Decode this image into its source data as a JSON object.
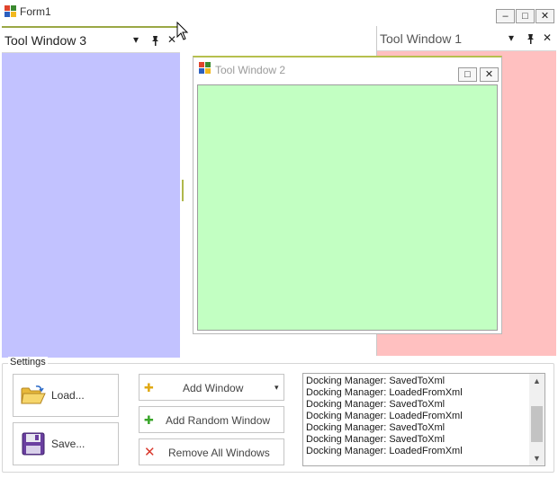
{
  "window": {
    "title": "Form1",
    "minimize_glyph": "–",
    "maximize_glyph": "□",
    "close_glyph": "✕"
  },
  "tool_window_3": {
    "title": "Tool Window 3",
    "color": "#c2c2ff"
  },
  "tool_window_1": {
    "title": "Tool Window 1",
    "color": "#ffc0c0"
  },
  "tool_window_2": {
    "title": "Tool Window 2",
    "color": "#c2ffc2",
    "maximize_glyph": "□",
    "close_glyph": "✕"
  },
  "header_icons": {
    "dropdown": "▾",
    "pin": "📌",
    "close": "✕"
  },
  "settings": {
    "label": "Settings",
    "load_label": "Load...",
    "save_label": "Save...",
    "add_window_label": "Add Window",
    "add_random_window_label": "Add Random Window",
    "remove_all_windows_label": "Remove All Windows"
  },
  "log": {
    "lines": [
      "Docking Manager: SavedToXml",
      "Docking Manager: LoadedFromXml",
      "Docking Manager: SavedToXml",
      "Docking Manager: LoadedFromXml",
      "Docking Manager: SavedToXml",
      "Docking Manager: SavedToXml",
      "Docking Manager: LoadedFromXml"
    ]
  }
}
